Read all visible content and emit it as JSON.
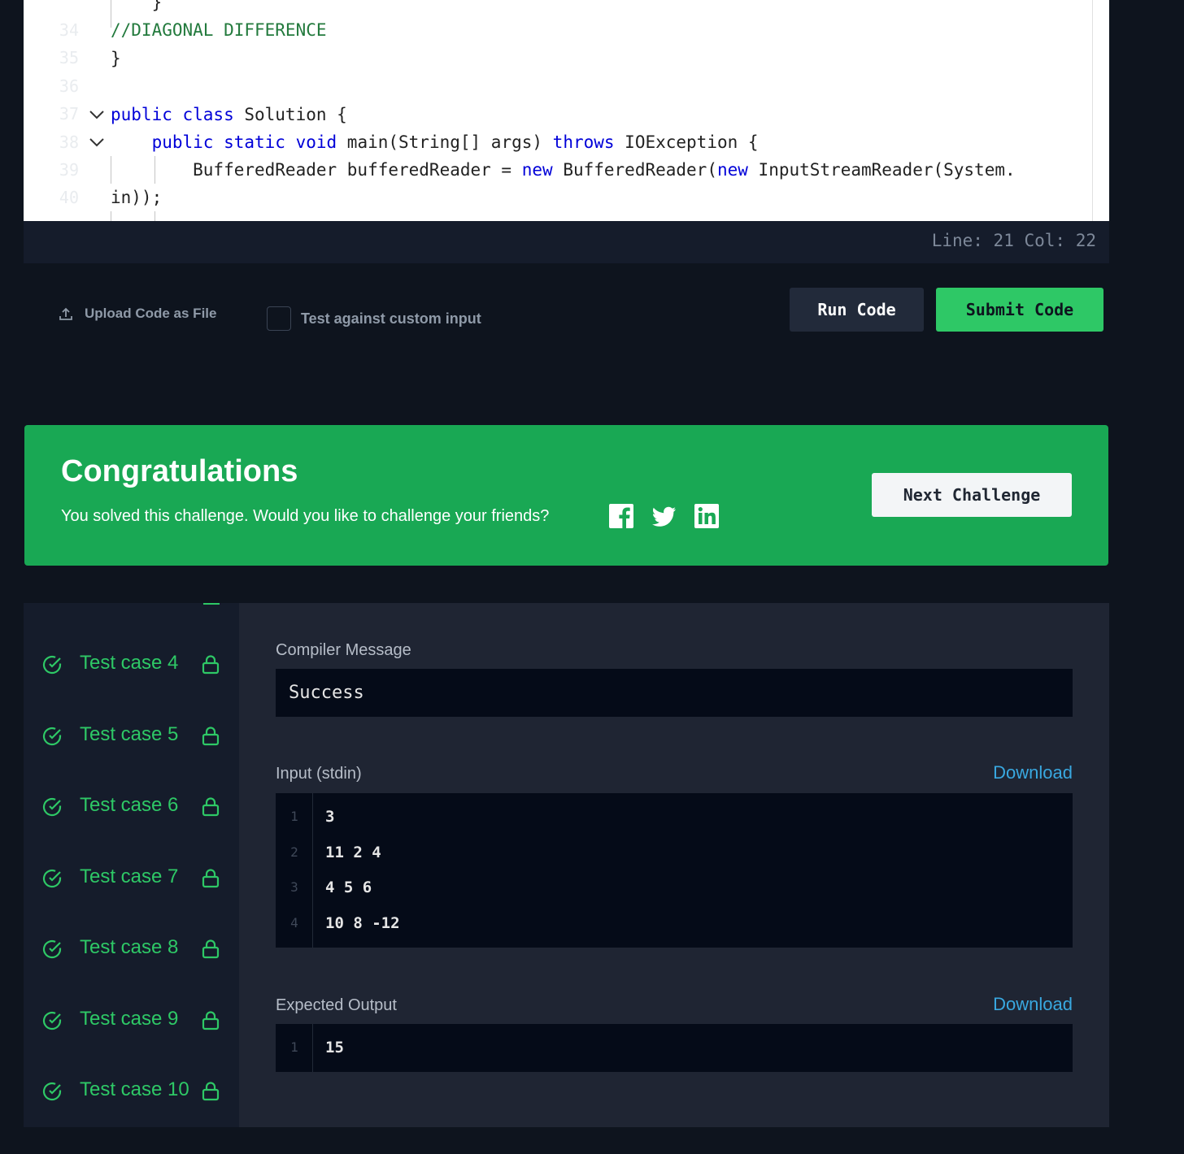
{
  "editor": {
    "lines": [
      {
        "num": "34",
        "text": "    }"
      },
      {
        "num": "35",
        "text": "//DIAGONAL DIFFERENCE"
      },
      {
        "num": "36",
        "text": "}"
      },
      {
        "num": "37",
        "text": ""
      },
      {
        "num": "38",
        "kw1": "public class",
        "text": " Solution {"
      },
      {
        "num": "39",
        "pre": "    ",
        "kw1": "public static void",
        "mid": " main(String[] args) ",
        "kw2": "throws",
        "post": " IOException {"
      },
      {
        "num": "40",
        "pre": "        BufferedReader bufferedReader = ",
        "kw1": "new",
        "mid": " BufferedReader(",
        "kw2": "new",
        "post": " InputStreamReader(System."
      },
      {
        "num": "",
        "text": "in));"
      }
    ],
    "status": "Line: 21 Col: 22"
  },
  "actions": {
    "upload_label": "Upload Code as File",
    "custom_input_label": "Test against custom input",
    "run_label": "Run Code",
    "submit_label": "Submit Code"
  },
  "congrats": {
    "title": "Congratulations",
    "message": "You solved this challenge. Would you like to challenge your friends?",
    "next_label": "Next Challenge",
    "social_icons": [
      "facebook-icon",
      "twitter-icon",
      "linkedin-icon"
    ]
  },
  "test_cases": [
    {
      "label": "Test case 4",
      "status": "passed",
      "locked": true
    },
    {
      "label": "Test case 5",
      "status": "passed",
      "locked": true
    },
    {
      "label": "Test case 6",
      "status": "passed",
      "locked": true
    },
    {
      "label": "Test case 7",
      "status": "passed",
      "locked": true
    },
    {
      "label": "Test case 8",
      "status": "passed",
      "locked": true
    },
    {
      "label": "Test case 9",
      "status": "passed",
      "locked": true
    },
    {
      "label": "Test case 10",
      "status": "passed",
      "locked": true
    }
  ],
  "result": {
    "compiler_label": "Compiler Message",
    "compiler_message": "Success",
    "input_label": "Input (stdin)",
    "input_download": "Download",
    "input_lines": [
      {
        "num": "1",
        "text": "3"
      },
      {
        "num": "2",
        "text": "11 2 4"
      },
      {
        "num": "3",
        "text": "4 5 6"
      },
      {
        "num": "4",
        "text": "10 8 -12"
      }
    ],
    "expected_label": "Expected Output",
    "expected_download": "Download",
    "expected_lines": [
      {
        "num": "1",
        "text": "15"
      }
    ]
  },
  "colors": {
    "accent_green": "#2ec866",
    "banner_green": "#19a854",
    "link_blue": "#39a8e0",
    "keyword_blue": "#0000d8",
    "comment_green": "#237a3d"
  }
}
